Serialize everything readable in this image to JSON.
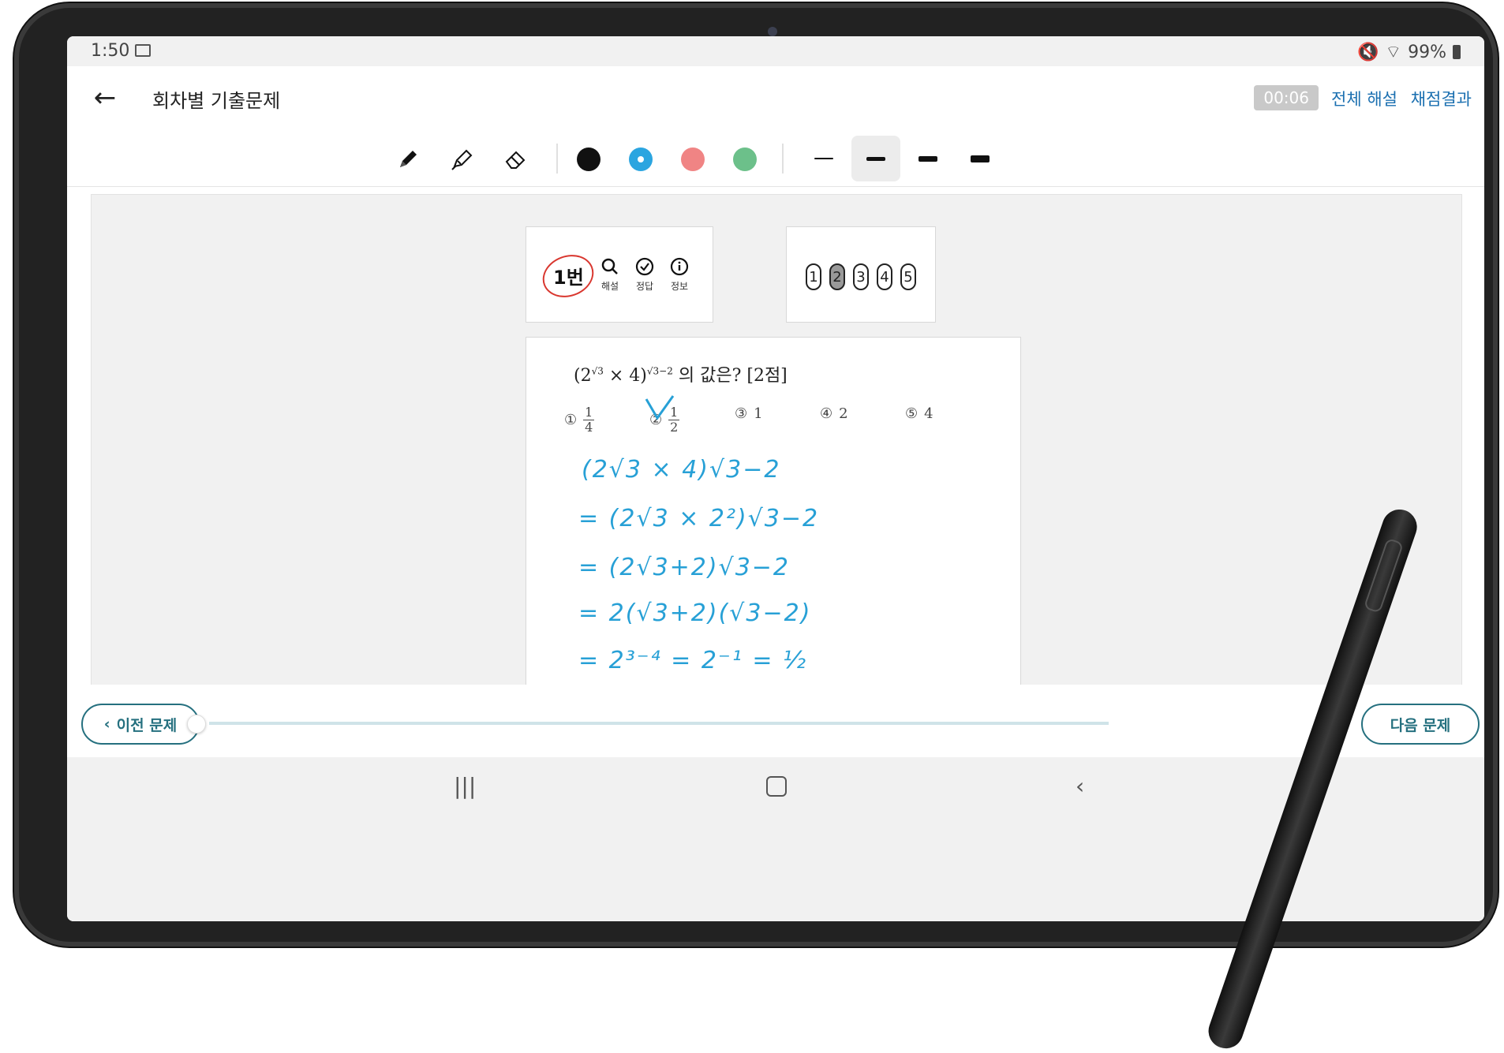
{
  "status": {
    "time": "1:50",
    "battery": "99%"
  },
  "header": {
    "title": "회차별 기출문제",
    "timer": "00:06",
    "link_explanations": "전체 해설",
    "link_results": "채점결과"
  },
  "toolbar": {
    "tools": [
      "pen-icon",
      "highlighter-icon",
      "eraser-icon"
    ],
    "colors": [
      "#111111",
      "#2ba5e0",
      "#f08484",
      "#6cc08a"
    ],
    "selected_color": "#2ba5e0",
    "thicknesses": [
      2,
      5,
      7,
      9
    ],
    "selected_thickness": 1
  },
  "question_panel": {
    "number": "1번",
    "tools": [
      {
        "icon": "search-icon",
        "label": "해설"
      },
      {
        "icon": "check-circle-icon",
        "label": "정답"
      },
      {
        "icon": "info-icon",
        "label": "정보"
      }
    ]
  },
  "answers": {
    "options": [
      "1",
      "2",
      "3",
      "4",
      "5"
    ],
    "selected": "2"
  },
  "problem": {
    "stem_suffix": "의 값은? [2점]",
    "choices": [
      {
        "mark": "①",
        "num": "1",
        "den": "4"
      },
      {
        "mark": "②",
        "num": "1",
        "den": "2"
      },
      {
        "mark": "③",
        "value": "1"
      },
      {
        "mark": "④",
        "value": "2"
      },
      {
        "mark": "⑤",
        "value": "4"
      }
    ],
    "handwriting": [
      "(2√3 × 4)√3−2",
      "= (2√3 × 2²)√3−2",
      "= (2√3+2)√3−2",
      "= 2(√3+2)(√3−2)",
      "= 2³⁻⁴ = 2⁻¹ = ½"
    ]
  },
  "bottom": {
    "prev": "이전 문제",
    "next": "다음 문제",
    "progress": 0
  }
}
